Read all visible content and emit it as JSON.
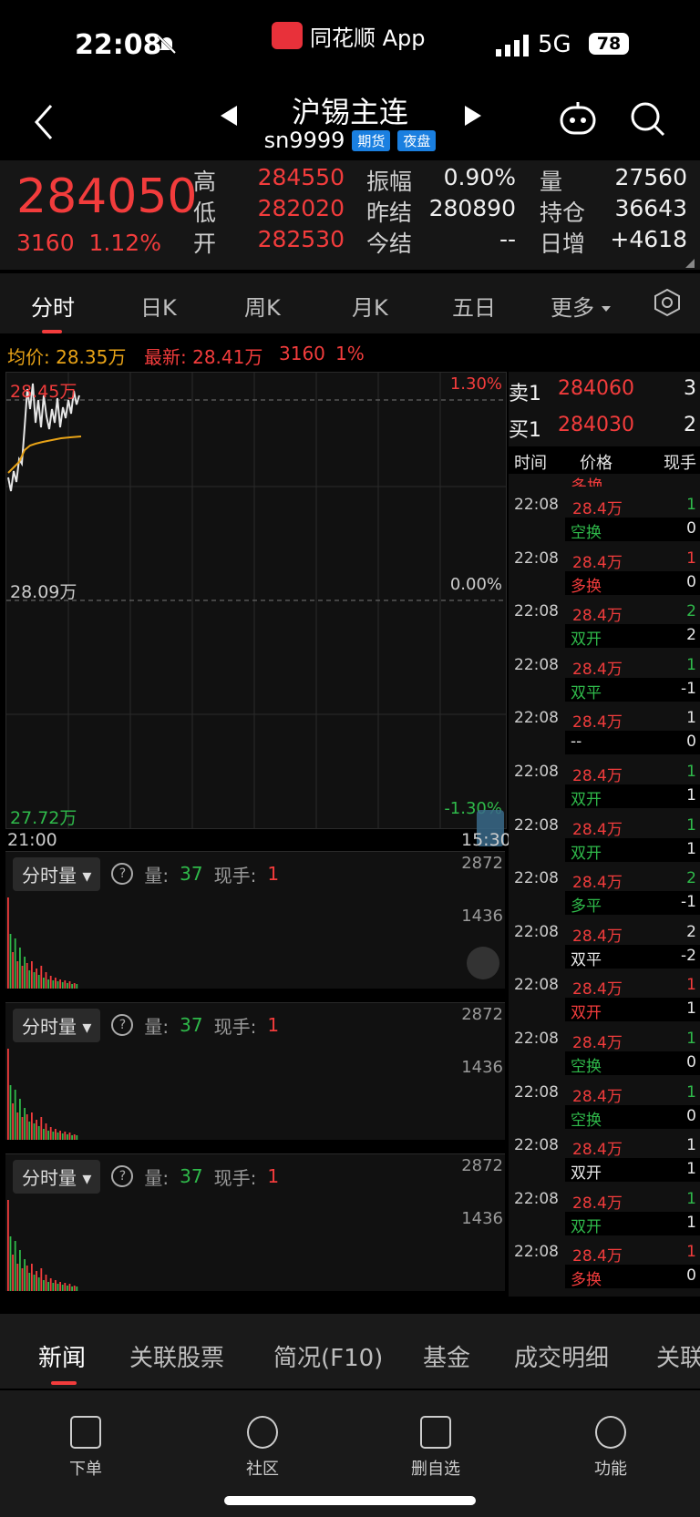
{
  "status_bar": {
    "time": "22:08",
    "app_name": "同花顺 App",
    "network": "5G",
    "battery": "78"
  },
  "header": {
    "title": "沪锡主连",
    "code": "sn9999",
    "tag_futures": "期货",
    "tag_night": "夜盘"
  },
  "quote": {
    "last_price": "284050",
    "change": "3160",
    "change_pct": "1.12%",
    "high_label": "高",
    "high": "284550",
    "low_label": "低",
    "low": "282020",
    "open_label": "开",
    "open": "282530",
    "amp_label": "振幅",
    "amp": "0.90%",
    "prev_settle_label": "昨结",
    "prev_settle": "280890",
    "settle_label": "今结",
    "settle": "--",
    "vol_label": "量",
    "vol": "27560",
    "oi_label": "持仓",
    "oi": "36643",
    "oi_chg_label": "日增",
    "oi_chg": "+4618"
  },
  "tabs": [
    "分时",
    "日K",
    "周K",
    "月K",
    "五日",
    "更多"
  ],
  "info": {
    "avg": "均价: 28.35万",
    "latest": "最新: 28.41万",
    "chg": "3160",
    "pct": "1%"
  },
  "chart": {
    "top_price": "28.45万",
    "mid_price": "28.09万",
    "bottom_price": "27.72万",
    "top_pct": "1.30%",
    "mid_pct": "0.00%",
    "bottom_pct": "-1.30%",
    "start_time": "21:00",
    "end_time": "15:30"
  },
  "vol_panels": [
    {
      "selector": "分时量",
      "vol_label": "量:",
      "vol": "37",
      "hand_label": "现手:",
      "hand": "1",
      "max": "2872",
      "mid": "1436"
    },
    {
      "selector": "分时量",
      "vol_label": "量:",
      "vol": "37",
      "hand_label": "现手:",
      "hand": "1",
      "max": "2872",
      "mid": "1436"
    },
    {
      "selector": "分时量",
      "vol_label": "量:",
      "vol": "37",
      "hand_label": "现手:",
      "hand": "1",
      "max": "2872",
      "mid": "1436"
    }
  ],
  "book": {
    "sell_label": "卖1",
    "sell_price": "284060",
    "sell_qty": "3",
    "buy_label": "买1",
    "buy_price": "284030",
    "buy_qty": "2",
    "col_time": "时间",
    "col_price": "价格",
    "col_qty": "现手",
    "top_partial": "多换",
    "trades": [
      {
        "time": "22:08",
        "price": "28.4万",
        "qty": "1",
        "type": "空换",
        "oi": "0",
        "qty_color": "green",
        "type_color": "green",
        "box": false
      },
      {
        "time": "22:08",
        "price": "28.4万",
        "qty": "1",
        "type": "多换",
        "oi": "0",
        "qty_color": "red",
        "type_color": "red",
        "box": false
      },
      {
        "time": "22:08",
        "price": "28.4万",
        "qty": "2",
        "type": "双开",
        "oi": "2",
        "qty_color": "green",
        "type_color": "green",
        "box": false
      },
      {
        "time": "22:08",
        "price": "28.4万",
        "qty": "1",
        "type": "双平",
        "oi": "-1",
        "qty_color": "green",
        "type_color": "green",
        "box": false
      },
      {
        "time": "22:08",
        "price": "28.4万",
        "qty": "1",
        "type": "--",
        "oi": "0",
        "qty_color": "white",
        "type_color": "white",
        "box": false
      },
      {
        "time": "22:08",
        "price": "28.4万",
        "qty": "1",
        "type": "双开",
        "oi": "1",
        "qty_color": "green",
        "type_color": "green",
        "box": false
      },
      {
        "time": "22:08",
        "price": "28.4万",
        "qty": "1",
        "type": "双开",
        "oi": "1",
        "qty_color": "green",
        "type_color": "green",
        "box": false
      },
      {
        "time": "22:08",
        "price": "28.4万",
        "qty": "2",
        "type": "多平",
        "oi": "-1",
        "qty_color": "green",
        "type_color": "green",
        "box": false
      },
      {
        "time": "22:08",
        "price": "28.4万",
        "qty": "2",
        "type": "双平",
        "oi": "-2",
        "qty_color": "white",
        "type_color": "white",
        "box": false
      },
      {
        "time": "22:08",
        "price": "28.4万",
        "qty": "1",
        "type": "双开",
        "oi": "1",
        "qty_color": "red",
        "type_color": "red",
        "box": false
      },
      {
        "time": "22:08",
        "price": "28.4万",
        "qty": "1",
        "type": "空换",
        "oi": "0",
        "qty_color": "green",
        "type_color": "green",
        "box": false
      },
      {
        "time": "22:08",
        "price": "28.4万",
        "qty": "1",
        "type": "空换",
        "oi": "0",
        "qty_color": "green",
        "type_color": "green",
        "box": false
      },
      {
        "time": "22:08",
        "price": "28.4万",
        "qty": "1",
        "type": "双开",
        "oi": "1",
        "qty_color": "white",
        "type_color": "white",
        "box": false
      },
      {
        "time": "22:08",
        "price": "28.4万",
        "qty": "1",
        "type": "双开",
        "oi": "1",
        "qty_color": "green",
        "type_color": "green",
        "box": false
      },
      {
        "time": "22:08",
        "price": "28.4万",
        "qty": "1",
        "type": "多换",
        "oi": "0",
        "qty_color": "red",
        "type_color": "red",
        "box": false
      }
    ]
  },
  "news_tabs": [
    "新闻",
    "关联股票",
    "简况(F10)",
    "基金",
    "成交明细",
    "关联"
  ],
  "nav": [
    "下单",
    "社区",
    "删自选",
    "功能"
  ],
  "colors": {
    "up": "#f23c3c",
    "down": "#2fb94a",
    "avg_line": "#e8a317",
    "bg": "#111111"
  }
}
